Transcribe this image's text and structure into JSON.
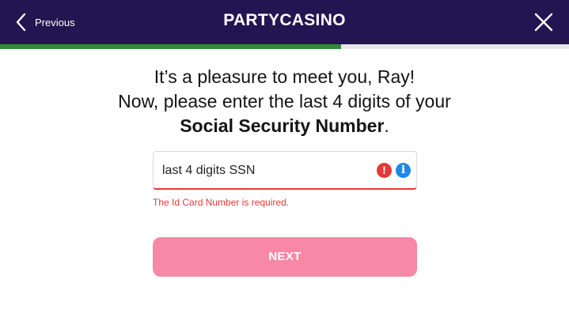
{
  "header": {
    "previous_label": "Previous",
    "logo_text": "PARTYCASINO",
    "background": "#231551"
  },
  "progress": {
    "value": 0.6,
    "fill_color": "#2e8b3a"
  },
  "heading": {
    "line1": "It’s a pleasure to meet you, Ray!",
    "line2": "Now, please enter the last 4 digits of your",
    "line3_bold": "Social Security Number",
    "line3_suffix": "."
  },
  "ssn_field": {
    "placeholder": "last 4 digits SSN",
    "value": "",
    "error_icon": "exclamation-icon",
    "info_icon": "info-icon",
    "error_message": "The Id Card Number is required."
  },
  "next_button": {
    "label": "NEXT",
    "color": "#f788a6"
  }
}
